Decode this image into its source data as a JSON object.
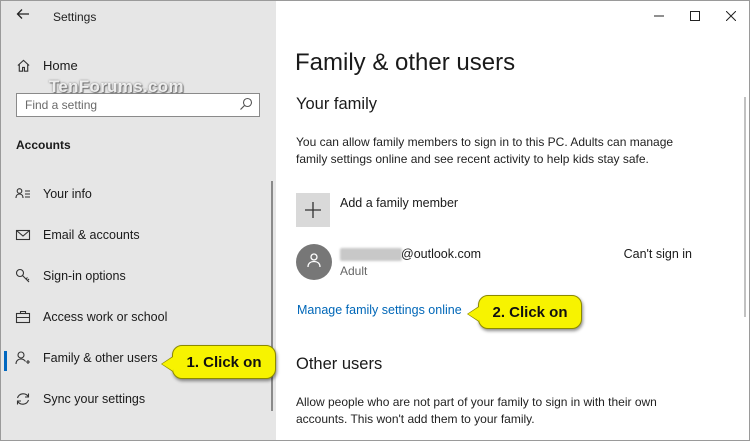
{
  "app": {
    "title": "Settings",
    "back_icon": "arrow-left-icon"
  },
  "sidebar": {
    "home_label": "Home",
    "watermark": "TenForums.com",
    "search": {
      "placeholder": "Find a setting"
    },
    "section_title": "Accounts",
    "items": [
      {
        "label": "Your info",
        "icon": "user-info-icon",
        "active": false
      },
      {
        "label": "Email & accounts",
        "icon": "mail-icon",
        "active": false
      },
      {
        "label": "Sign-in options",
        "icon": "key-icon",
        "active": false
      },
      {
        "label": "Access work or school",
        "icon": "briefcase-icon",
        "active": false
      },
      {
        "label": "Family & other users",
        "icon": "person-add-icon",
        "active": true
      },
      {
        "label": "Sync your settings",
        "icon": "sync-icon",
        "active": false
      }
    ]
  },
  "window_controls": {
    "minimize": "—",
    "maximize": "☐",
    "close": "✕"
  },
  "main": {
    "page_title": "Family & other users",
    "your_family": {
      "heading": "Your family",
      "description": "You can allow family members to sign in to this PC. Adults can manage family settings online and see recent activity to help kids stay safe.",
      "add_member_label": "Add a family member",
      "member": {
        "email": "@outlook.com",
        "role": "Adult",
        "status": "Can't sign in"
      },
      "manage_link": "Manage family settings online"
    },
    "other_users": {
      "heading": "Other users",
      "description": "Allow people who are not part of your family to sign in with their own accounts. This won't add them to your family."
    }
  },
  "annotations": {
    "callout1": "1. Click on",
    "callout2": "2. Click on",
    "color": "#f7f300"
  },
  "colors": {
    "accent": "#0067c0",
    "link": "#0067b8",
    "sidebar_bg": "#e6e6e6"
  }
}
